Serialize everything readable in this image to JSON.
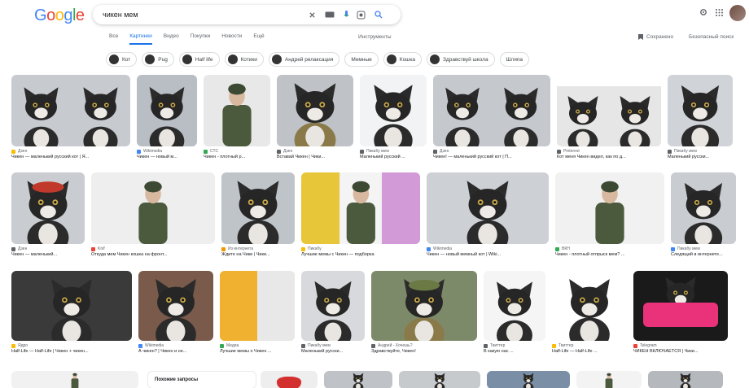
{
  "logo": [
    "G",
    "o",
    "o",
    "g",
    "l",
    "e"
  ],
  "search": {
    "query": "чикен мем"
  },
  "tabs": [
    {
      "label": "Все",
      "active": false
    },
    {
      "label": "Картинки",
      "active": true
    },
    {
      "label": "Видео",
      "active": false
    },
    {
      "label": "Покупки",
      "active": false
    },
    {
      "label": "Новости",
      "active": false
    },
    {
      "label": "Ещё",
      "active": false
    }
  ],
  "tools_label": "Инструменты",
  "saved_label": "Сохранено",
  "safe_label": "Безопасный поиск",
  "chips": [
    {
      "label": "Кот",
      "thumb": true
    },
    {
      "label": "Pug",
      "thumb": true
    },
    {
      "label": "Half life",
      "thumb": true
    },
    {
      "label": "Котики",
      "thumb": true
    },
    {
      "label": "Андрей релаксация",
      "thumb": true
    },
    {
      "label": "Мемные",
      "thumb": false
    },
    {
      "label": "Кошка",
      "thumb": true
    },
    {
      "label": "Здравствуй школа",
      "thumb": true
    },
    {
      "label": "Шляпа",
      "thumb": false
    }
  ],
  "rows": [
    [
      {
        "w": 146,
        "kind": "cat2",
        "bg": "#c7cbd0",
        "source": "Дзен",
        "caption": "Чикен — маленький русский кот | Я...",
        "fav": "#fbbc05"
      },
      {
        "w": 74,
        "kind": "cat",
        "bg": "#b9bec4",
        "source": "Wikimedia",
        "caption": "Чикен — новый м...",
        "fav": "#4285f4"
      },
      {
        "w": 82,
        "kind": "soldier",
        "bg": "#e8e8e8",
        "source": "СТС",
        "caption": "Чикен - плотный р...",
        "fav": "#34a853"
      },
      {
        "w": 94,
        "kind": "catuni",
        "bg": "#bfc3c8",
        "source": "Дзен",
        "caption": "Вставай Чикен | Чики...",
        "fav": "#5f6368"
      },
      {
        "w": 82,
        "kind": "catsmall",
        "bg": "#f1f3f4",
        "source": "Пикабу мем",
        "caption": "Маленький русский ...",
        "fav": "#5f6368"
      },
      {
        "w": 144,
        "kind": "cat2",
        "bg": "#c5c9ce",
        "source": "Дзен",
        "caption": "Чикен! — маленький русский кот | П...",
        "fav": "#5f6368"
      },
      {
        "w": 128,
        "kind": "doc",
        "bg": "#e6e6e6",
        "source": "Pinterest",
        "caption": "Кот меня Чикен видел, как по д...",
        "fav": "#5f6368"
      },
      {
        "w": 80,
        "kind": "cat",
        "bg": "#d0d3d7",
        "source": "Пикабу мем",
        "caption": "Маленький русски...",
        "fav": "#5f6368"
      }
    ],
    [
      {
        "w": 90,
        "kind": "cathat",
        "bg": "#c9ccd0",
        "source": "Дзен",
        "caption": "Чикен — маленький...",
        "fav": "#5f6368"
      },
      {
        "w": 152,
        "kind": "soldier",
        "bg": "#eeeeee",
        "source": "Knif",
        "caption": "Откуда мем Чикен кошка на фронт...",
        "fav": "#ea4335"
      },
      {
        "w": 90,
        "kind": "cat",
        "bg": "#bfc4c9",
        "source": "Из интернета",
        "caption": "Ждите на Чики | Чики...",
        "fav": "#f29900"
      },
      {
        "w": 146,
        "kind": "collage",
        "bg": "#f2f2f2",
        "source": "Пикабу",
        "caption": "Лучшие мемы с Чикен — подборка",
        "fav": "#fbbc05"
      },
      {
        "w": 150,
        "kind": "catbig",
        "bg": "#cdd1d5",
        "source": "Wikimedia",
        "caption": "Чикен — новый мемный кот | Wiki...",
        "fav": "#4285f4"
      },
      {
        "w": 134,
        "kind": "soldier",
        "bg": "#f1f1f1",
        "source": "ВКН",
        "caption": "Чикен - плотный отпрыск мем? ...",
        "fav": "#34a853"
      },
      {
        "w": 80,
        "kind": "cat",
        "bg": "#c9cdd1",
        "source": "Пикабу мем",
        "caption": "Следящий в интернете...",
        "fav": "#4285f4"
      }
    ],
    [
      {
        "w": 148,
        "kind": "catsuit",
        "bg": "#3a3a3a",
        "source": "Ядро",
        "caption": "Half-Life — Half-Life | Чикен + чикен...",
        "fav": "#fbbc05"
      },
      {
        "w": 92,
        "kind": "catpink",
        "bg": "#7a5a4a",
        "source": "Wikimedia",
        "caption": "А чикен? | Чикен и не...",
        "fav": "#4285f4"
      },
      {
        "w": 92,
        "kind": "meme",
        "bg": "#f0c040",
        "source": "Медиа",
        "caption": "Лучшие мемы о Чикен ...",
        "fav": "#34a853"
      },
      {
        "w": 78,
        "kind": "catsmall",
        "bg": "#d7d9dc",
        "source": "Пикабу мем",
        "caption": "Маленький русски...",
        "fav": "#5f6368"
      },
      {
        "w": 130,
        "kind": "catarmy",
        "bg": "#7d8a6a",
        "source": "Андрей - Хочешь?",
        "caption": "Здравствуйте, Чикен!",
        "fav": "#5f6368"
      },
      {
        "w": 76,
        "kind": "catframe",
        "bg": "#f5f5f5",
        "source": "Твиттер",
        "caption": "В какую нас ...",
        "fav": "#5f6368"
      },
      {
        "w": 92,
        "kind": "catclean",
        "bg": "#ffffff",
        "source": "Твиттер",
        "caption": "Half-Life — Half-Life ...",
        "fav": "#fbbc05"
      },
      {
        "w": 116,
        "kind": "catcar",
        "bg": "#1a1a1a",
        "source": "Telegram",
        "caption": "ЧИКЕН ВКЛЮЧАЕТСЯ | Чики...",
        "fav": "#ea4335"
      }
    ],
    [
      {
        "w": 156,
        "kind": "soldier",
        "bg": "#f1f1f1",
        "source": "",
        "caption": "",
        "fav": "#5f6368"
      },
      {
        "w": 134,
        "kind": "related",
        "bg": "#ffffff",
        "source": "",
        "caption": "",
        "fav": "#5f6368"
      },
      {
        "w": 70,
        "kind": "hat",
        "bg": "#eeeeee",
        "source": "",
        "caption": "",
        "fav": "#5f6368"
      },
      {
        "w": 84,
        "kind": "cat",
        "bg": "#bfc3c7",
        "source": "",
        "caption": "",
        "fav": "#5f6368"
      },
      {
        "w": 100,
        "kind": "cat",
        "bg": "#c7cacd",
        "source": "",
        "caption": "",
        "fav": "#5f6368"
      },
      {
        "w": 102,
        "kind": "cat",
        "bg": "#7a8fa6",
        "source": "",
        "caption": "",
        "fav": "#5f6368"
      },
      {
        "w": 80,
        "kind": "soldier",
        "bg": "#f3f3f3",
        "source": "",
        "caption": "",
        "fav": "#5f6368"
      },
      {
        "w": 92,
        "kind": "cat",
        "bg": "#b5b9bd",
        "source": "",
        "caption": "",
        "fav": "#5f6368"
      }
    ]
  ],
  "related_title": "Похожие запросы"
}
